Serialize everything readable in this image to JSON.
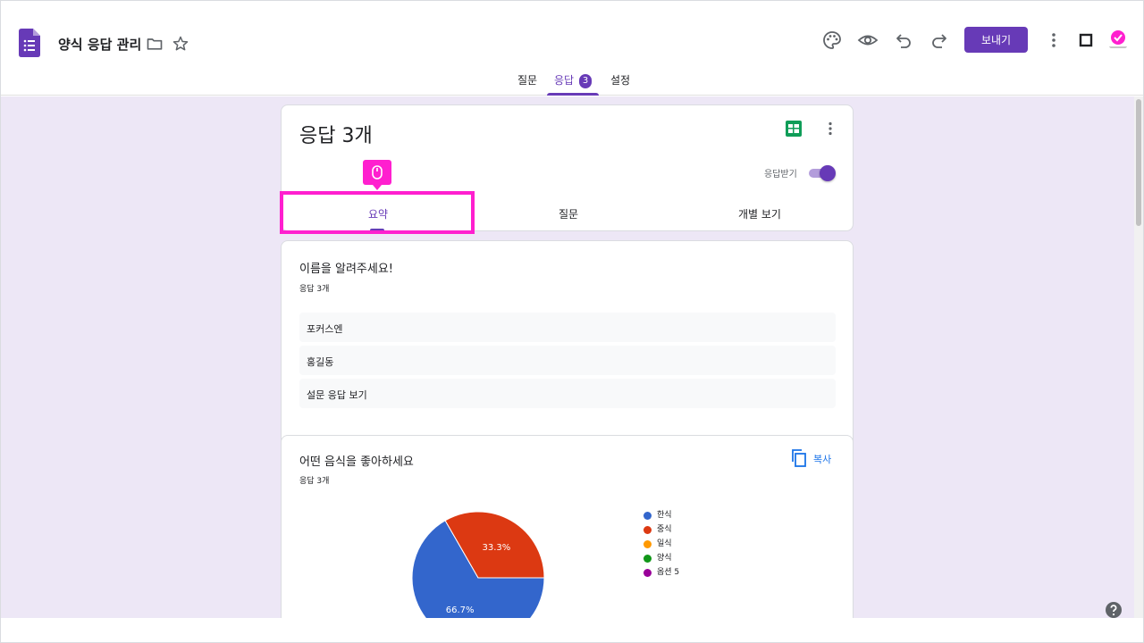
{
  "doc": {
    "title": "양식 응답 관리"
  },
  "header": {
    "send_label": "보내기"
  },
  "top_tabs": [
    {
      "label": "질문"
    },
    {
      "label": "응답",
      "badge": "3"
    },
    {
      "label": "설정"
    }
  ],
  "responses": {
    "title": "응답 3개",
    "accept_label": "응답받기",
    "accepting": true,
    "tabs": [
      {
        "label": "요약"
      },
      {
        "label": "질문"
      },
      {
        "label": "개별 보기"
      }
    ]
  },
  "question1": {
    "title": "이름을 알려주세요!",
    "count": "응답 3개",
    "answers": [
      "포커스엔",
      "홍길동",
      "설문 응답 보기"
    ]
  },
  "question2": {
    "title": "어떤 음식을 좋아하세요",
    "count": "응답 3개",
    "copy_label": "복사"
  },
  "chart_data": {
    "type": "pie",
    "categories": [
      "한식",
      "중식",
      "일식",
      "양식",
      "옵션 5"
    ],
    "values": [
      66.7,
      33.3,
      0,
      0,
      0
    ],
    "labels": [
      "66.7%",
      "33.3%",
      "",
      "",
      ""
    ],
    "colors": [
      "#3366cc",
      "#dc3912",
      "#ff9900",
      "#109618",
      "#990099"
    ],
    "legend": "right"
  },
  "colors": {
    "accent": "#673ab7",
    "highlight": "#ff1fcf",
    "background": "#ede7f6"
  }
}
